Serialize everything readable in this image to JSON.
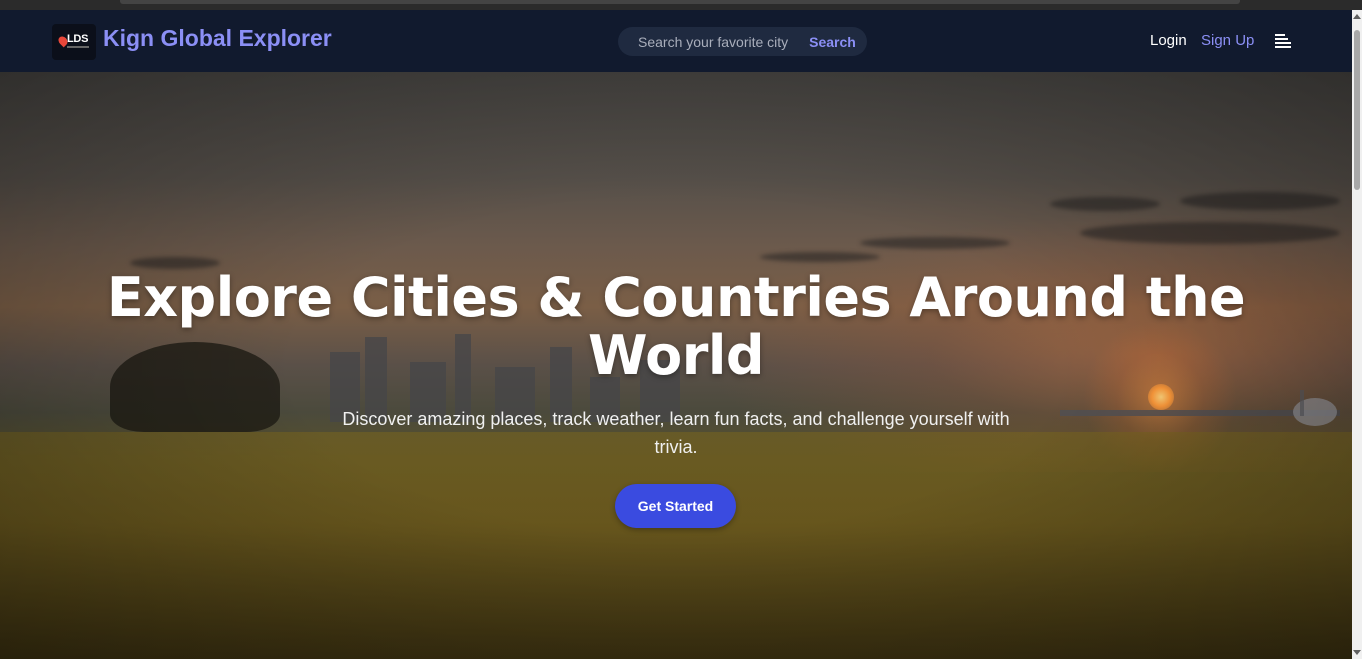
{
  "header": {
    "logo_text": "LDS",
    "brand": "Kign Global Explorer",
    "login_label": "Login",
    "signup_label": "Sign Up",
    "menu_icon": "menu-icon"
  },
  "search": {
    "placeholder": "Search your favorite city",
    "value": "",
    "button_label": "Search"
  },
  "hero": {
    "title_line1": "Explore Cities & Countries Around the",
    "title_line2": "World",
    "subtitle": "Discover amazing places, track weather, learn fun facts, and challenge yourself with trivia.",
    "cta_label": "Get Started"
  },
  "colors": {
    "navbar_bg": "#111a2e",
    "brand_accent": "#8b8ff5",
    "cta_bg": "#3a4be0"
  }
}
